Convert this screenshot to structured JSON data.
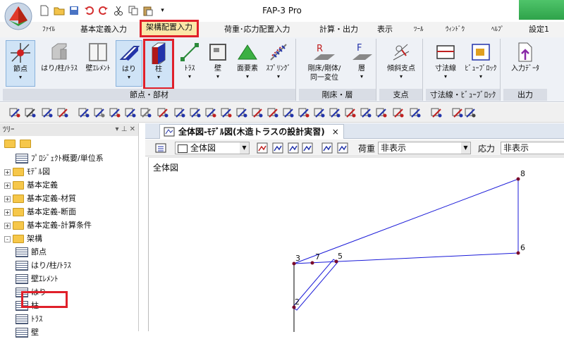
{
  "app": {
    "title": "FAP-3 Pro"
  },
  "menu": {
    "items": [
      {
        "label": "ﾌｧｲﾙ",
        "small": true
      },
      {
        "label": "基本定義入力"
      },
      {
        "label": "架構配置入力",
        "active": true
      },
      {
        "label": "荷重･応力配置入力"
      },
      {
        "label": "計算・出力"
      },
      {
        "label": "表示"
      },
      {
        "label": "ﾂｰﾙ",
        "small": true
      },
      {
        "label": "ｳｨﾝﾄﾞｳ",
        "small": true
      },
      {
        "label": "ﾍﾙﾌﾟ",
        "small": true
      },
      {
        "label": "設定1"
      }
    ]
  },
  "ribbon": {
    "groups": [
      {
        "label": "節点・部材",
        "buttons": [
          {
            "l1": "節点",
            "l2": "",
            "dropdown": true,
            "icon": "node-icon"
          },
          {
            "l1": "はり/柱/ﾄﾗｽ",
            "l2": "",
            "dropdown": false,
            "icon": "beam-column-truss-icon"
          },
          {
            "l1": "壁ｴﾚﾒﾝﾄ",
            "l2": "",
            "dropdown": false,
            "icon": "wall-element-icon"
          },
          {
            "l1": "はり",
            "l2": "",
            "dropdown": true,
            "icon": "beam-icon"
          },
          {
            "l1": "柱",
            "l2": "",
            "dropdown": true,
            "icon": "column-icon"
          },
          {
            "l1": "ﾄﾗｽ",
            "l2": "",
            "dropdown": true,
            "icon": "truss-icon"
          },
          {
            "l1": "壁",
            "l2": "",
            "dropdown": true,
            "icon": "wall-icon"
          },
          {
            "l1": "面要素",
            "l2": "",
            "dropdown": true,
            "icon": "surface-element-icon"
          },
          {
            "l1": "ｽﾌﾟﾘﾝｸﾞ",
            "l2": "",
            "dropdown": true,
            "icon": "spring-icon"
          }
        ]
      },
      {
        "label": "剛床・層",
        "buttons": [
          {
            "l1": "剛床/剛体/",
            "l2": "同一変位",
            "dropdown": true,
            "icon": "rigid-floor-icon"
          },
          {
            "l1": "層",
            "l2": "",
            "dropdown": true,
            "icon": "floor-layer-icon"
          }
        ]
      },
      {
        "label": "支点",
        "buttons": [
          {
            "l1": "傾斜支点",
            "l2": "",
            "dropdown": true,
            "icon": "inclined-support-icon"
          }
        ]
      },
      {
        "label": "寸法線・ﾋﾞｭｰﾌﾞﾛｯｸ",
        "buttons": [
          {
            "l1": "寸法線",
            "l2": "",
            "dropdown": true,
            "icon": "dimension-line-icon"
          },
          {
            "l1": "ﾋﾞｭｰﾌﾞﾛｯｸ",
            "l2": "",
            "dropdown": true,
            "icon": "view-block-icon"
          }
        ]
      },
      {
        "label": "出力",
        "buttons": [
          {
            "l1": "入力ﾃﾞｰﾀ",
            "l2": "",
            "dropdown": false,
            "icon": "input-data-icon"
          }
        ]
      }
    ]
  },
  "panel": {
    "title": "ﾂﾘｰ",
    "tree": [
      {
        "label": "ﾌﾟﾛｼﾞｪｸﾄ概要/単位系",
        "kind": "doc",
        "level": 1
      },
      {
        "label": "ﾓﾃﾞﾙ図",
        "kind": "folder",
        "level": 0,
        "exp": "+"
      },
      {
        "label": "基本定義",
        "kind": "folder",
        "level": 0,
        "exp": "+"
      },
      {
        "label": "基本定義-材質",
        "kind": "folder",
        "level": 0,
        "exp": "+"
      },
      {
        "label": "基本定義-断面",
        "kind": "folder",
        "level": 0,
        "exp": "+"
      },
      {
        "label": "基本定義-計算条件",
        "kind": "folder",
        "level": 0,
        "exp": "+"
      },
      {
        "label": "架構",
        "kind": "folder",
        "level": 0,
        "exp": "-"
      },
      {
        "label": "節点",
        "kind": "doc",
        "level": 1
      },
      {
        "label": "はり/柱/ﾄﾗｽ",
        "kind": "doc",
        "level": 1
      },
      {
        "label": "壁ｴﾚﾒﾝﾄ",
        "kind": "doc",
        "level": 1
      },
      {
        "label": "はり",
        "kind": "doc",
        "level": 1
      },
      {
        "label": "柱",
        "kind": "doc",
        "level": 1,
        "highlight": true
      },
      {
        "label": "ﾄﾗｽ",
        "kind": "doc",
        "level": 1
      },
      {
        "label": "壁",
        "kind": "doc",
        "level": 1
      }
    ]
  },
  "document": {
    "tab_label": "全体図-ﾓﾃﾞﾙ図(木造トラスの設計実習)",
    "close": "×",
    "view_combo": "全体図",
    "load_label": "荷重",
    "load_value": "非表示",
    "stress_label": "応力",
    "stress_value": "非表示",
    "canvas_title": "全体図"
  },
  "model": {
    "nodes": [
      {
        "id": "2"
      },
      {
        "id": "3"
      },
      {
        "id": "5"
      },
      {
        "id": "6"
      },
      {
        "id": "7"
      },
      {
        "id": "8"
      }
    ]
  },
  "colors": {
    "accent_red": "#e0202a",
    "member_blue": "#1a1ad8",
    "node": "#7a0a2a"
  }
}
